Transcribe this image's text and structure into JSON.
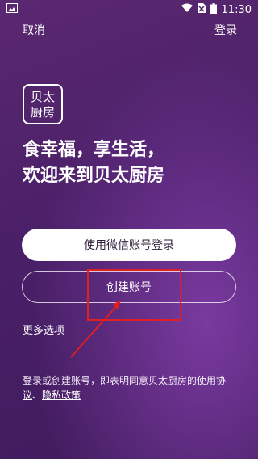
{
  "status": {
    "time": "11:30"
  },
  "topbar": {
    "cancel": "取消",
    "login": "登录"
  },
  "logo": {
    "line1": "贝太",
    "line2": "厨房"
  },
  "headline": {
    "line1": "食幸福，享生活，",
    "line2": "欢迎来到贝太厨房"
  },
  "buttons": {
    "wechat": "使用微信账号登录",
    "create": "创建账号"
  },
  "more": "更多选项",
  "terms": {
    "prefix": "登录或创建账号，即表明同意贝太厨房的",
    "agreement": "使用协议",
    "sep": "、",
    "privacy": "隐私政策"
  },
  "colors": {
    "highlight": "#e02020"
  }
}
